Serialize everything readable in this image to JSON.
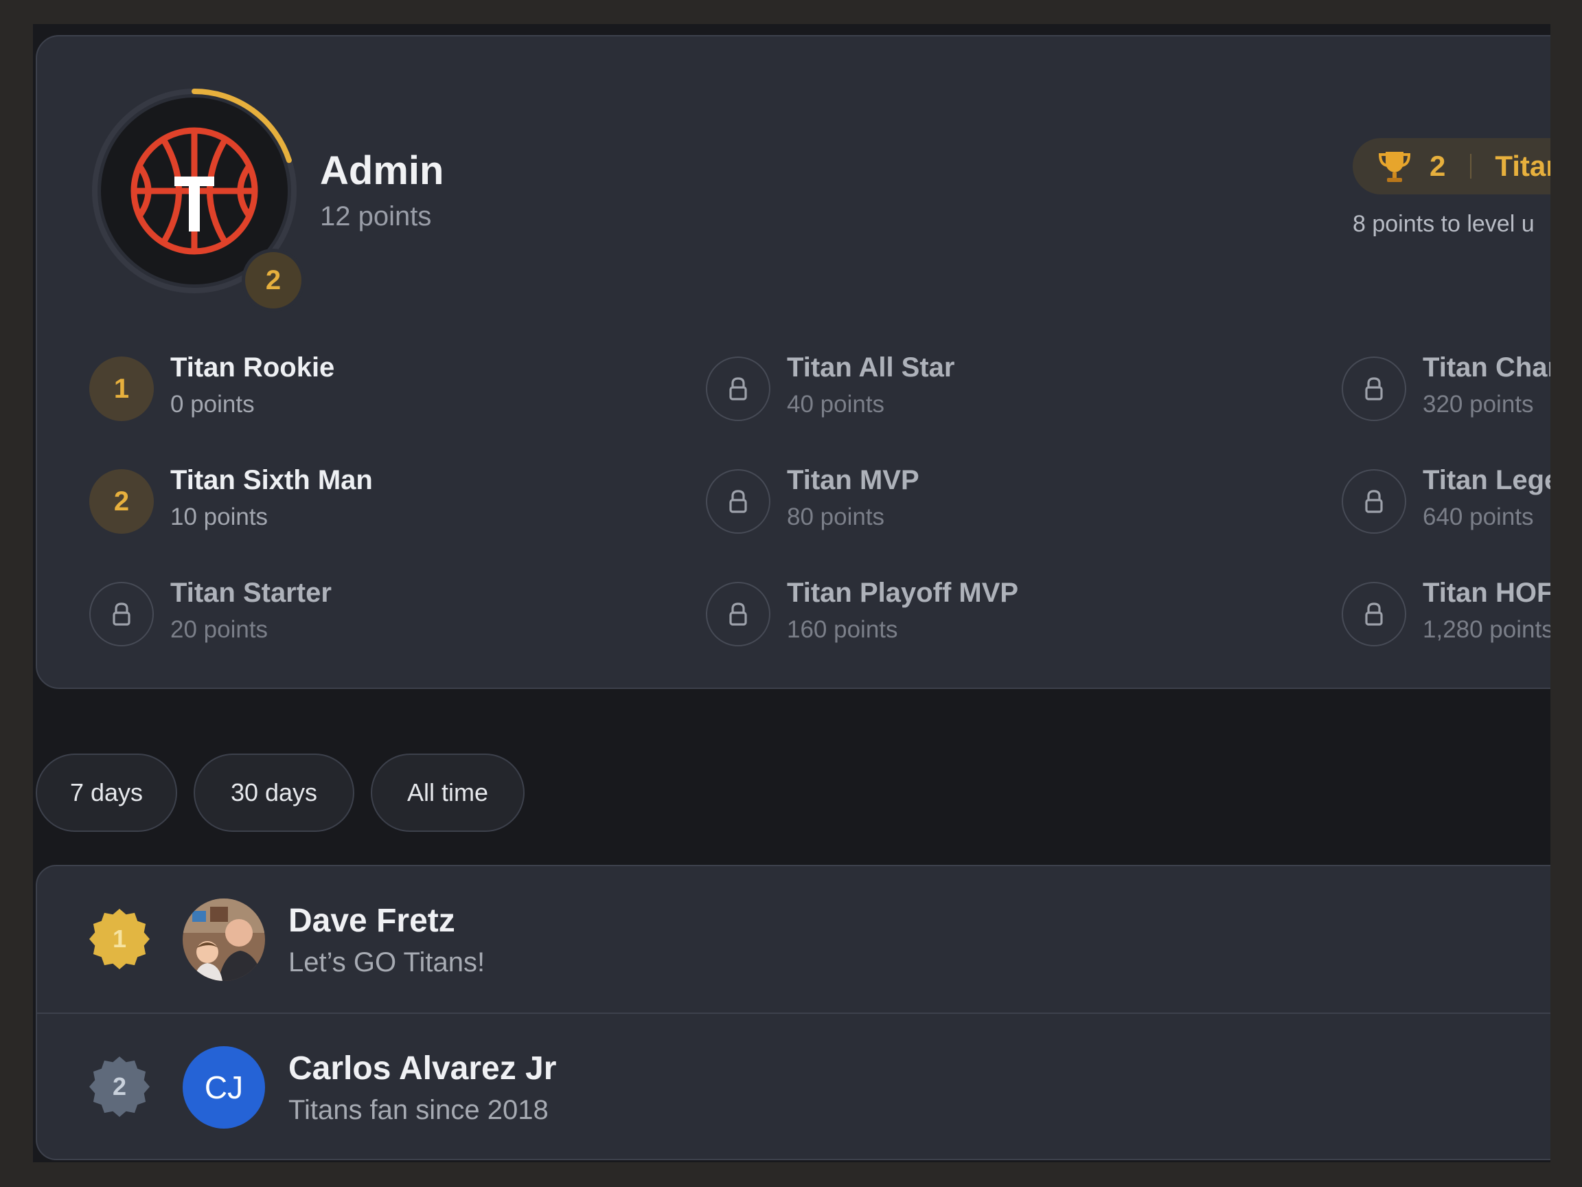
{
  "profile": {
    "name": "Admin",
    "points": "12 points",
    "level_badge": "2",
    "level_pill": {
      "level": "2",
      "title": "Titan"
    },
    "level_hint": "8 points to level u",
    "progress_fraction": 0.2,
    "logo_letter": "T"
  },
  "levels": [
    {
      "badge": "1",
      "name": "Titan Rookie",
      "points": "0 points",
      "earned": true
    },
    {
      "badge": "2",
      "name": "Titan Sixth Man",
      "points": "10 points",
      "earned": true
    },
    {
      "badge": "",
      "name": "Titan Starter",
      "points": "20 points",
      "earned": false
    },
    {
      "badge": "",
      "name": "Titan All Star",
      "points": "40 points",
      "earned": false
    },
    {
      "badge": "",
      "name": "Titan MVP",
      "points": "80 points",
      "earned": false
    },
    {
      "badge": "",
      "name": "Titan Playoff MVP",
      "points": "160 points",
      "earned": false
    },
    {
      "badge": "",
      "name": "Titan Chan",
      "points": "320 points",
      "earned": false
    },
    {
      "badge": "",
      "name": "Titan Lege",
      "points": "640 points",
      "earned": false
    },
    {
      "badge": "",
      "name": "Titan HOF",
      "points": "1,280 points",
      "earned": false
    }
  ],
  "filters": [
    "7 days",
    "30 days",
    "All time"
  ],
  "leaderboard": [
    {
      "rank": "1",
      "name": "Dave Fretz",
      "bio": "Let’s GO Titans!",
      "avatar": "photo",
      "initials": "",
      "badge_color": "#e2b642",
      "badge_text_color": "#f6e3a0"
    },
    {
      "rank": "2",
      "name": "Carlos Alvarez Jr",
      "bio": "Titans fan since 2018",
      "avatar": "initials",
      "initials": "CJ",
      "badge_color": "#5f6a7b",
      "badge_text_color": "#c9d1dc"
    }
  ],
  "colors": {
    "accent": "#e7b03d",
    "card": "#2b2e37",
    "background": "#18191d",
    "logo_red": "#e0422a"
  },
  "icons": {
    "trophy": "trophy-icon",
    "lock": "lock-icon",
    "logo": "basketball-logo"
  }
}
